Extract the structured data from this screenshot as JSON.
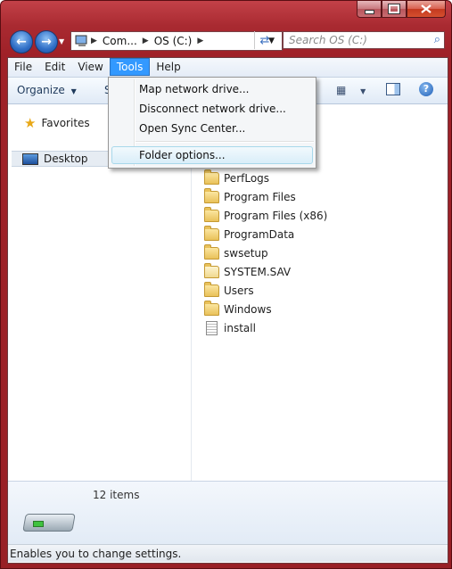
{
  "window": {
    "caption_buttons": [
      "minimize-icon",
      "maximize-icon",
      "close-icon"
    ],
    "colors": {
      "frame": "#a92a31",
      "accent": "#3399ff"
    }
  },
  "nav": {
    "back_icon": "back-arrow-icon",
    "forward_icon": "forward-arrow-icon",
    "breadcrumb": [
      "Com...",
      "OS (C:)"
    ],
    "search_placeholder": "Search OS (C:)"
  },
  "menubar": {
    "items": [
      "File",
      "Edit",
      "View",
      "Tools",
      "Help"
    ],
    "active": "Tools"
  },
  "toolbar": {
    "organize_label": "Organize",
    "partial_label": "S"
  },
  "tools_menu": {
    "items": [
      "Map network drive...",
      "Disconnect network drive...",
      "Open Sync Center...",
      "Folder options..."
    ],
    "highlighted": "Folder options..."
  },
  "navpane": {
    "favorites": "Favorites",
    "desktop": "Desktop"
  },
  "files": [
    {
      "name": "PerfLogs",
      "icon": "folder-icon"
    },
    {
      "name": "Program Files",
      "icon": "folder-icon"
    },
    {
      "name": "Program Files (x86)",
      "icon": "folder-icon"
    },
    {
      "name": "ProgramData",
      "icon": "folder-icon"
    },
    {
      "name": "swsetup",
      "icon": "folder-icon"
    },
    {
      "name": "SYSTEM.SAV",
      "icon": "folder-icon"
    },
    {
      "name": "Users",
      "icon": "folder-icon"
    },
    {
      "name": "Windows",
      "icon": "folder-icon"
    },
    {
      "name": "install",
      "icon": "document-icon"
    }
  ],
  "details": {
    "item_count": "12 items"
  },
  "statusbar": {
    "text": "Enables you to change settings."
  }
}
